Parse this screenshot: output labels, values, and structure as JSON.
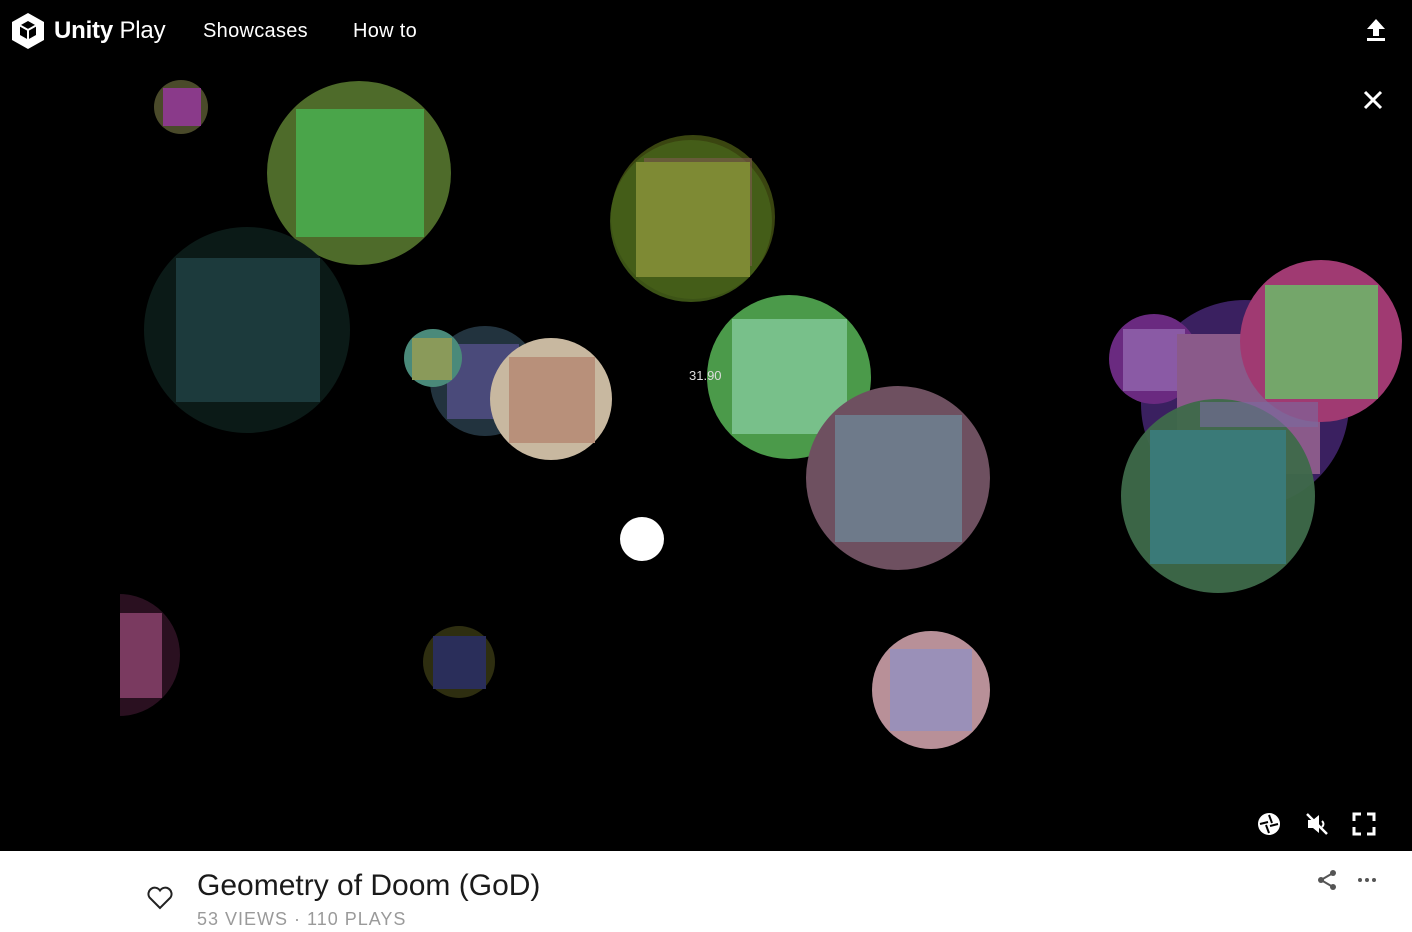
{
  "header": {
    "logo_bold": "Unity",
    "logo_light": "Play",
    "nav": [
      "Showcases",
      "How to"
    ],
    "upload_icon": "upload-icon",
    "close_icon": "close-icon"
  },
  "game": {
    "score_text": "31.90",
    "controls": [
      "screenshot-icon",
      "mute-icon",
      "fullscreen-icon"
    ]
  },
  "info": {
    "title": "Geometry of Doom (GoD)",
    "stats": "53 VIEWS · 110 PLAYS",
    "like_icon": "heart-icon",
    "share_icon": "share-icon",
    "more_icon": "more-icon"
  },
  "colors": {
    "background": "#000000",
    "text_dark": "#1a1a1a",
    "text_muted": "#9a9a9a"
  }
}
